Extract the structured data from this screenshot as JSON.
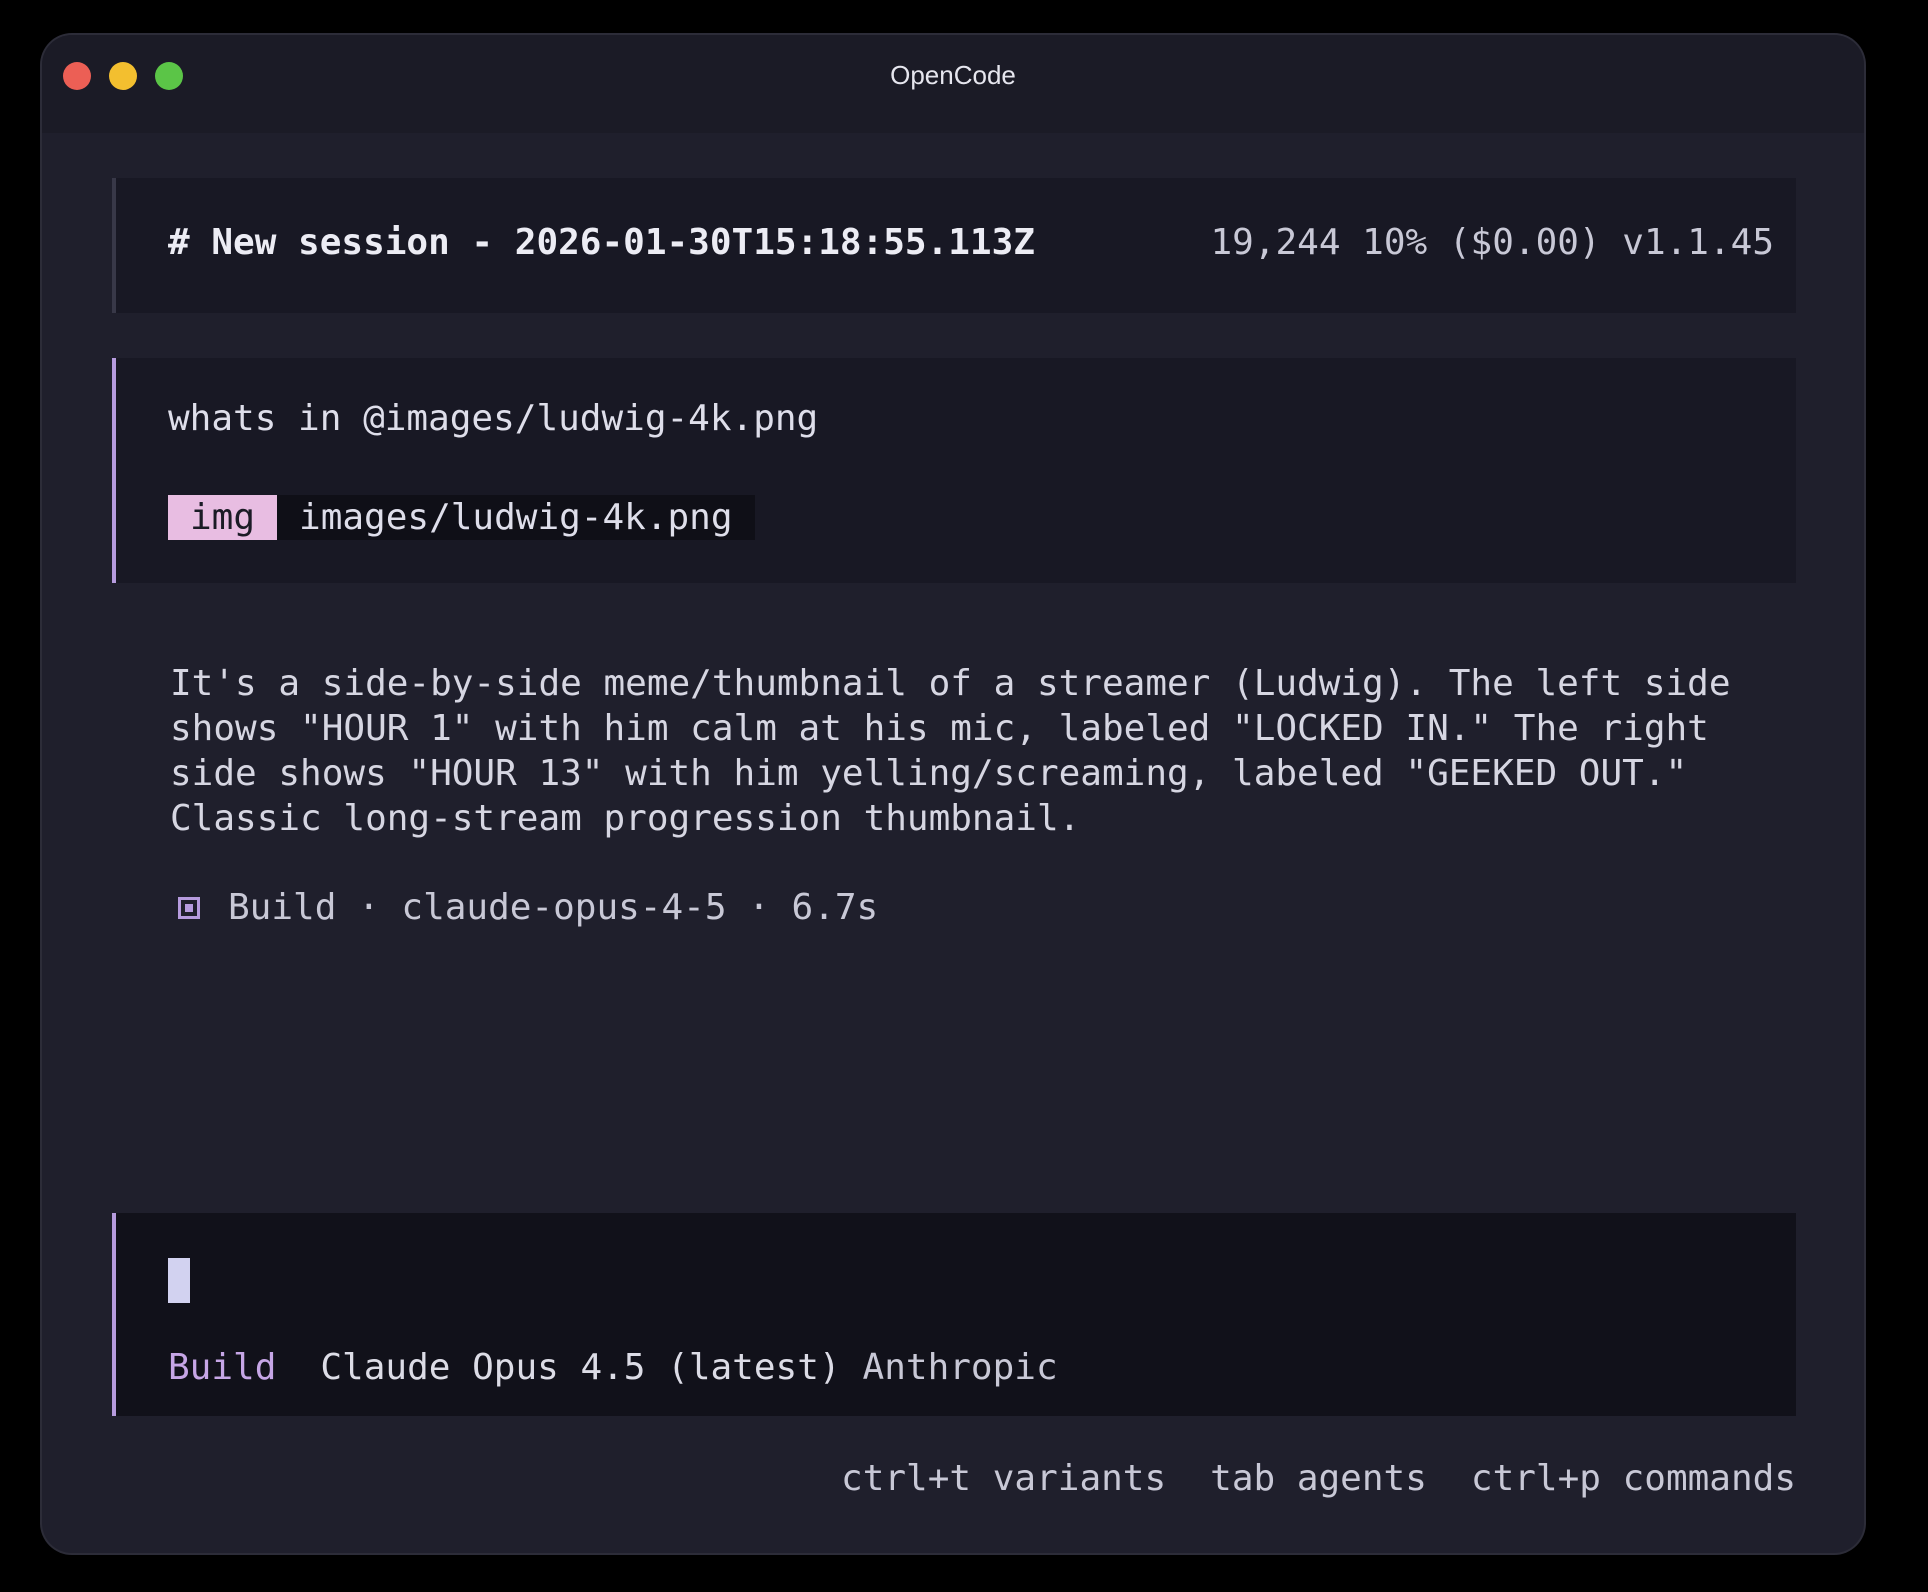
{
  "window": {
    "title": "OpenCode"
  },
  "header": {
    "session_title": "# New session - 2026-01-30T15:18:55.113Z",
    "meta": "19,244  10% ($0.00) v1.1.45"
  },
  "user_message": {
    "text": "whats in @images/ludwig-4k.png",
    "attachment": {
      "badge": "img",
      "name": "images/ludwig-4k.png"
    }
  },
  "response": {
    "text": "It's a side-by-side meme/thumbnail of a streamer (Ludwig). The left side shows \"HOUR 1\" with him calm at his mic, labeled \"LOCKED IN.\" The right side shows \"HOUR 13\" with him yelling/screaming, labeled \"GEEKED OUT.\" Classic long-stream progression thumbnail.",
    "build_info": "Build · claude-opus-4-5 · 6.7s",
    "build_icon": "square-dot-icon"
  },
  "input": {
    "agent": "Build",
    "model": "Claude Opus 4.5 (latest)",
    "provider": "Anthropic"
  },
  "hints": [
    "ctrl+t variants",
    "tab agents",
    "ctrl+p commands"
  ],
  "colors": {
    "accent": "#b69bde",
    "badge": "#e8bde2",
    "background": "#1f1f2c"
  }
}
